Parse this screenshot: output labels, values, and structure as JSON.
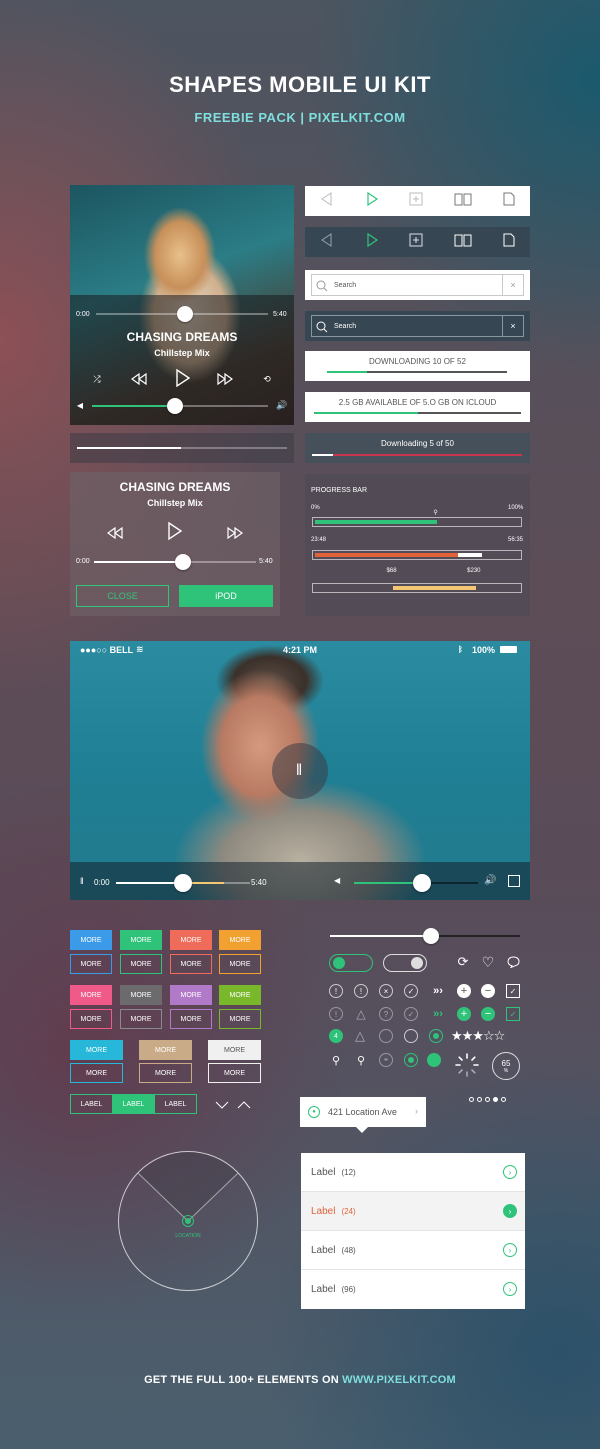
{
  "header": {
    "title": "SHAPES MOBILE UI KIT",
    "subtitle": "FREEBIE PACK  |  PIXELKIT.COM"
  },
  "footer": {
    "text": "GET THE FULL 100+ ELEMENTS ON ",
    "link": "WWW.PIXELKIT.COM"
  },
  "player1": {
    "time_start": "0:00",
    "time_end": "5:40",
    "song": "CHASING DREAMS",
    "artist": "Chillstep Mix",
    "progress": 0.52,
    "volume": 0.47
  },
  "player2": {
    "song": "CHASING DREAMS",
    "artist": "Chillstep Mix",
    "time_start": "0:00",
    "time_end": "5:40",
    "progress": 0.55,
    "close_label": "CLOSE",
    "ipod_label": "iPOD"
  },
  "search": {
    "placeholder": "Search",
    "clear": "×"
  },
  "downloads": {
    "d1": {
      "label": "DOWNLOADING 10 OF 52",
      "progress": 0.22
    },
    "d2": {
      "label": "2.5 GB AVAILABLE OF 5.O GB ON ICLOUD",
      "progress": 0.5
    },
    "d3": {
      "label": "Downloading  5  of 50",
      "progress": 0.1
    }
  },
  "progress_bars": {
    "title": "PROGRESS BAR",
    "b1": {
      "min": "0%",
      "max": "100%",
      "value": 0.6
    },
    "b2": {
      "start": "23:48",
      "end": "56:35",
      "value": 0.7,
      "buffer": 0.82
    },
    "b3": {
      "low": "$68",
      "high": "$230",
      "from": 0.38,
      "to": 0.79
    }
  },
  "video": {
    "carrier": "●●●○○ BELL",
    "time": "4:21 PM",
    "battery": "100%",
    "time_start": "0:00",
    "time_end": "5:40",
    "progress": 0.5,
    "volume": 0.55
  },
  "buttons": {
    "more": "MORE",
    "label": "LABEL"
  },
  "badge": {
    "count": "4"
  },
  "rating": {
    "stars": 3,
    "max": 5
  },
  "gauge": {
    "value": "65",
    "unit": "%"
  },
  "location": {
    "address": "421 Location Ave",
    "radar_label": "LOCATION"
  },
  "list": [
    {
      "label": "Label",
      "count": "(12)"
    },
    {
      "label": "Label",
      "count": "(24)",
      "active": true
    },
    {
      "label": "Label",
      "count": "(48)"
    },
    {
      "label": "Label",
      "count": "(96)"
    }
  ],
  "colors": {
    "accent": "#2fc37a",
    "accent_teal": "#7fdede",
    "orange": "#e2623a",
    "yellow": "#f3c773"
  }
}
